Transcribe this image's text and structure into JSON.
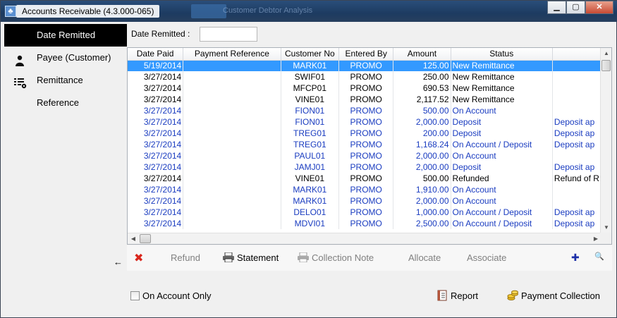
{
  "window": {
    "title": "Accounts Receivable (4.3.000-065)",
    "background_title": "Customer Debtor Analysis",
    "buttons": {
      "minimize": "▁",
      "maximize": "▢",
      "close": "✕"
    }
  },
  "sidebar": {
    "items": [
      {
        "label": "Date Remitted",
        "icon": "none",
        "active": true
      },
      {
        "label": "Payee (Customer)",
        "icon": "person-icon",
        "active": false
      },
      {
        "label": "Remittance Reference",
        "icon": "list-settings-icon",
        "active": false
      }
    ],
    "collapse_icon": "←"
  },
  "filter": {
    "label": "Date Remitted :",
    "value": ""
  },
  "grid": {
    "columns": [
      "Date Paid",
      "Payment Reference",
      "Customer No",
      "Entered By",
      "Amount",
      "Status",
      ""
    ],
    "rows": [
      {
        "style": "sel",
        "date": "5/19/2014",
        "ref": "",
        "cust": "MARK01",
        "by": "PROMO",
        "amount": "125.00",
        "status": "New Remittance",
        "extra": ""
      },
      {
        "style": "black",
        "date": "3/27/2014",
        "ref": "",
        "cust": "SWIF01",
        "by": "PROMO",
        "amount": "250.00",
        "status": "New Remittance",
        "extra": ""
      },
      {
        "style": "black",
        "date": "3/27/2014",
        "ref": "",
        "cust": "MFCP01",
        "by": "PROMO",
        "amount": "690.53",
        "status": "New Remittance",
        "extra": ""
      },
      {
        "style": "black",
        "date": "3/27/2014",
        "ref": "",
        "cust": "VINE01",
        "by": "PROMO",
        "amount": "2,117.52",
        "status": "New Remittance",
        "extra": ""
      },
      {
        "style": "blue",
        "date": "3/27/2014",
        "ref": "",
        "cust": "FION01",
        "by": "PROMO",
        "amount": "500.00",
        "status": "On Account",
        "extra": ""
      },
      {
        "style": "blue",
        "date": "3/27/2014",
        "ref": "",
        "cust": "FION01",
        "by": "PROMO",
        "amount": "2,000.00",
        "status": "Deposit",
        "extra": "Deposit ap"
      },
      {
        "style": "blue",
        "date": "3/27/2014",
        "ref": "",
        "cust": "TREG01",
        "by": "PROMO",
        "amount": "200.00",
        "status": "Deposit",
        "extra": "Deposit ap"
      },
      {
        "style": "blue",
        "date": "3/27/2014",
        "ref": "",
        "cust": "TREG01",
        "by": "PROMO",
        "amount": "1,168.24",
        "status": "On Account / Deposit",
        "extra": "Deposit ap"
      },
      {
        "style": "blue",
        "date": "3/27/2014",
        "ref": "",
        "cust": "PAUL01",
        "by": "PROMO",
        "amount": "2,000.00",
        "status": "On Account",
        "extra": ""
      },
      {
        "style": "blue",
        "date": "3/27/2014",
        "ref": "",
        "cust": "JAMJ01",
        "by": "PROMO",
        "amount": "2,000.00",
        "status": "Deposit",
        "extra": "Deposit ap"
      },
      {
        "style": "black",
        "date": "3/27/2014",
        "ref": "",
        "cust": "VINE01",
        "by": "PROMO",
        "amount": "500.00",
        "status": "Refunded",
        "extra": "Refund of R"
      },
      {
        "style": "blue",
        "date": "3/27/2014",
        "ref": "",
        "cust": "MARK01",
        "by": "PROMO",
        "amount": "1,910.00",
        "status": "On Account",
        "extra": ""
      },
      {
        "style": "blue",
        "date": "3/27/2014",
        "ref": "",
        "cust": "MARK01",
        "by": "PROMO",
        "amount": "2,000.00",
        "status": "On Account",
        "extra": ""
      },
      {
        "style": "blue",
        "date": "3/27/2014",
        "ref": "",
        "cust": "DELO01",
        "by": "PROMO",
        "amount": "1,000.00",
        "status": "On Account / Deposit",
        "extra": "Deposit ap"
      },
      {
        "style": "blue",
        "date": "3/27/2014",
        "ref": "",
        "cust": "MDVI01",
        "by": "PROMO",
        "amount": "2,500.00",
        "status": "On Account / Deposit",
        "extra": "Deposit ap"
      }
    ]
  },
  "toolbar": {
    "delete_icon": "✖",
    "refund": "Refund",
    "statement": "Statement",
    "collection_note": "Collection Note",
    "allocate": "Allocate",
    "associate": "Associate",
    "add_icon": "✚",
    "search_icon": "🔍"
  },
  "footer": {
    "on_account_only": "On Account Only",
    "report": "Report",
    "payment_collection": "Payment Collection"
  },
  "colors": {
    "selection": "#3399ff",
    "blue_text": "#1a3cc0",
    "delete_red": "#d9261c",
    "add_blue": "#1c2fa8"
  }
}
